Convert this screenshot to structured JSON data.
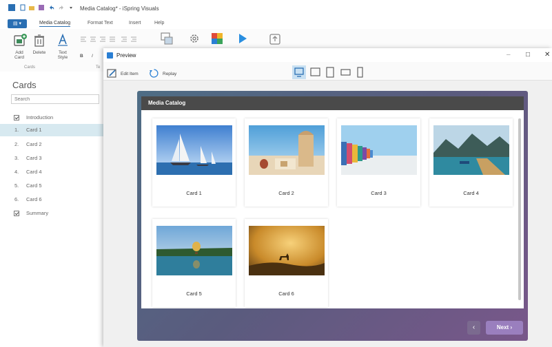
{
  "app": {
    "title": "Media Catalog* - iSpring Visuals"
  },
  "ribbon": {
    "file_label": "",
    "tabs": [
      "Media Catalog",
      "Format Text",
      "Insert",
      "Help"
    ],
    "add_card": "Add Card",
    "delete": "Delete",
    "text_style": "Text Style",
    "bold": "B",
    "italic": "I",
    "group_cards": "Cards",
    "group_text": "Te"
  },
  "sidebar": {
    "title": "Cards",
    "search_placeholder": "Search",
    "items": [
      {
        "num": "",
        "label": "Introduction",
        "check": true
      },
      {
        "num": "1.",
        "label": "Card 1"
      },
      {
        "num": "2.",
        "label": "Card 2"
      },
      {
        "num": "3.",
        "label": "Card 3"
      },
      {
        "num": "4.",
        "label": "Card 4"
      },
      {
        "num": "5.",
        "label": "Card 5"
      },
      {
        "num": "6.",
        "label": "Card 6"
      },
      {
        "num": "",
        "label": "Summary",
        "check": true
      }
    ]
  },
  "preview": {
    "title": "Preview",
    "edit_item": "Edit Item",
    "replay": "Replay",
    "minimize": "–",
    "maximize": "□",
    "close": "✕"
  },
  "slide": {
    "header": "Media Catalog",
    "cards": [
      "Card 1",
      "Card 2",
      "Card 3",
      "Card 4",
      "Card 5",
      "Card 6"
    ],
    "prev": "‹",
    "next": "Next ›"
  },
  "colors": {
    "accent": "#2a6fb3",
    "selected": "#d7e9f0",
    "next_button": "#9a7fbe"
  }
}
